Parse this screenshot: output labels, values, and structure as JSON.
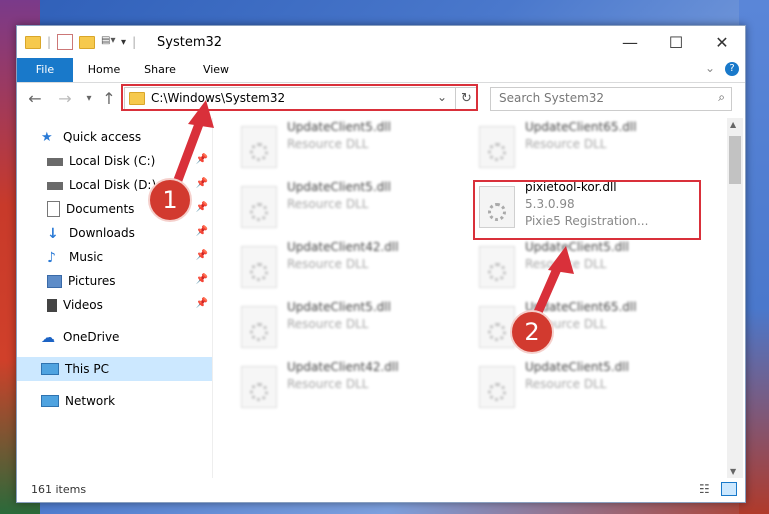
{
  "window": {
    "title": "System32"
  },
  "ribbon": {
    "tabs": [
      "File",
      "Home",
      "Share",
      "View"
    ]
  },
  "address": {
    "path": "C:\\Windows\\System32"
  },
  "search": {
    "placeholder": "Search System32"
  },
  "sidebar": {
    "quick_access": "Quick access",
    "items": [
      "Local Disk (C:)",
      "Local Disk (D:)",
      "Documents",
      "Downloads",
      "Music",
      "Pictures",
      "Videos"
    ],
    "onedrive": "OneDrive",
    "thispc": "This PC",
    "network": "Network"
  },
  "files": {
    "left": [
      {
        "name": "UpdateClient5.dll",
        "type": "Resource DLL"
      },
      {
        "name": "UpdateClient5.dll",
        "type": "Resource DLL"
      },
      {
        "name": "UpdateClient42.dll",
        "type": "Resource DLL"
      },
      {
        "name": "UpdateClient5.dll",
        "type": "Resource DLL"
      },
      {
        "name": "UpdateClient42.dll",
        "type": "Resource DLL"
      }
    ],
    "right": [
      {
        "name": "UpdateClient65.dll",
        "type": "Resource DLL"
      },
      {
        "name": "UpdateClient5.dll",
        "type": "Resource DLL"
      },
      {
        "name": "UpdateClient65.dll",
        "type": "Resource DLL"
      },
      {
        "name": "UpdateClient5.dll",
        "type": "Resource DLL"
      }
    ],
    "target": {
      "name": "pixietool-kor.dll",
      "version": "5.3.0.98",
      "description": "Pixie5 Registration..."
    }
  },
  "status": {
    "count": "161 items"
  },
  "badges": {
    "one": "1",
    "two": "2"
  },
  "colors": {
    "accent": "#1979ca",
    "highlight": "#d9303a"
  }
}
